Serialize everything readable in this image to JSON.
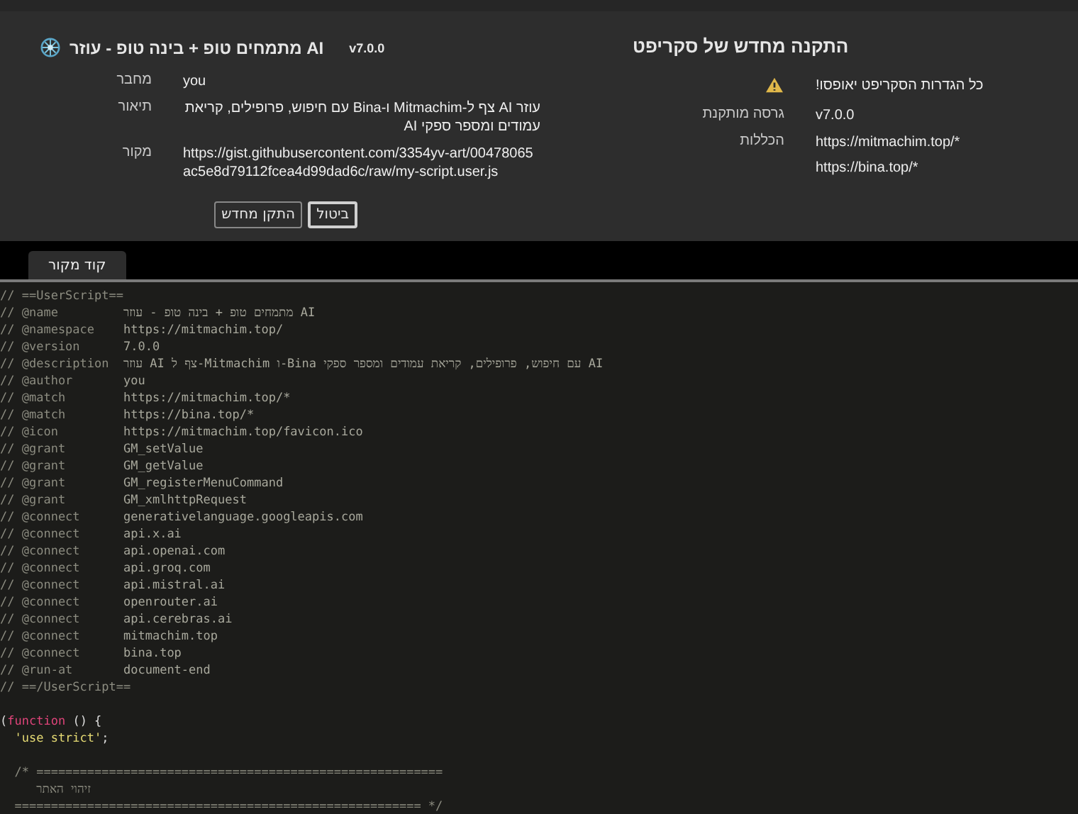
{
  "script": {
    "name": "מתמחים טופ + בינה טופ - עוזר AI",
    "version": "v7.0.0",
    "details": [
      {
        "label": "מחבר",
        "value": "you"
      },
      {
        "label": "תיאור",
        "value": "עוזר AI צף ל-Mitmachim ו-Bina עם חיפוש, פרופילים, קריאת עמודים ומספר ספקי AI"
      },
      {
        "label": "מקור",
        "value": "https://gist.githubusercontent.com/3354yv-art/00478065ac5e8d79112fcea4d99dad6c/raw/my-script.user.js"
      }
    ],
    "buttons": [
      {
        "label": "ביטול",
        "focused": true
      },
      {
        "label": "התקן מחדש",
        "focused": false
      }
    ]
  },
  "reinstall": {
    "title": "התקנה מחדש של סקריפט",
    "warning": "כל הגדרות הסקריפט יאופסו!",
    "rows": [
      {
        "label": "גרסה מותקנת",
        "values": [
          "v7.0.0"
        ]
      },
      {
        "label": "הכללות",
        "values": [
          "https://mitmachim.top/*",
          "https://bina.top/*"
        ]
      }
    ]
  },
  "tabs": [
    {
      "label": "קוד מקור",
      "selected": true
    }
  ],
  "code": [
    {
      "kind": "comment",
      "text": "// ==UserScript=="
    },
    {
      "kind": "meta",
      "key": "// @name",
      "value": "מתמחים טופ + בינה טופ - עוזר AI"
    },
    {
      "kind": "meta",
      "key": "// @namespace",
      "value": "https://mitmachim.top/"
    },
    {
      "kind": "meta",
      "key": "// @version",
      "value": "7.0.0"
    },
    {
      "kind": "meta",
      "key": "// @description",
      "value": "עוזר AI צף ל-Mitmachim ו-Bina עם חיפוש, פרופילים, קריאת עמודים ומספר ספקי AI"
    },
    {
      "kind": "meta",
      "key": "// @author",
      "value": "you"
    },
    {
      "kind": "meta",
      "key": "// @match",
      "value": "https://mitmachim.top/*"
    },
    {
      "kind": "meta",
      "key": "// @match",
      "value": "https://bina.top/*"
    },
    {
      "kind": "meta",
      "key": "// @icon",
      "value": "https://mitmachim.top/favicon.ico"
    },
    {
      "kind": "meta",
      "key": "// @grant",
      "value": "GM_setValue"
    },
    {
      "kind": "meta",
      "key": "// @grant",
      "value": "GM_getValue"
    },
    {
      "kind": "meta",
      "key": "// @grant",
      "value": "GM_registerMenuCommand"
    },
    {
      "kind": "meta",
      "key": "// @grant",
      "value": "GM_xmlhttpRequest"
    },
    {
      "kind": "meta",
      "key": "// @connect",
      "value": "generativelanguage.googleapis.com"
    },
    {
      "kind": "meta",
      "key": "// @connect",
      "value": "api.x.ai"
    },
    {
      "kind": "meta",
      "key": "// @connect",
      "value": "api.openai.com"
    },
    {
      "kind": "meta",
      "key": "// @connect",
      "value": "api.groq.com"
    },
    {
      "kind": "meta",
      "key": "// @connect",
      "value": "api.mistral.ai"
    },
    {
      "kind": "meta",
      "key": "// @connect",
      "value": "openrouter.ai"
    },
    {
      "kind": "meta",
      "key": "// @connect",
      "value": "api.cerebras.ai"
    },
    {
      "kind": "meta",
      "key": "// @connect",
      "value": "mitmachim.top"
    },
    {
      "kind": "meta",
      "key": "// @connect",
      "value": "bina.top"
    },
    {
      "kind": "meta",
      "key": "// @run-at",
      "value": "document-end"
    },
    {
      "kind": "comment",
      "text": "// ==/UserScript=="
    },
    {
      "kind": "code",
      "gap_before": true,
      "tokens": [
        {
          "kind": "punct",
          "text": "("
        },
        {
          "kind": "keyword",
          "text": "function"
        },
        {
          "kind": "punct",
          "text": " () {"
        }
      ]
    },
    {
      "kind": "code",
      "tokens": [
        {
          "kind": "string",
          "text": "  'use strict'"
        },
        {
          "kind": "punct",
          "text": ";"
        }
      ]
    },
    {
      "kind": "comment",
      "gap_before": true,
      "text": "  /* ========================================================"
    },
    {
      "kind": "comment",
      "text": "     זיהוי האתר"
    },
    {
      "kind": "comment",
      "text": "  ======================================================== */"
    }
  ]
}
